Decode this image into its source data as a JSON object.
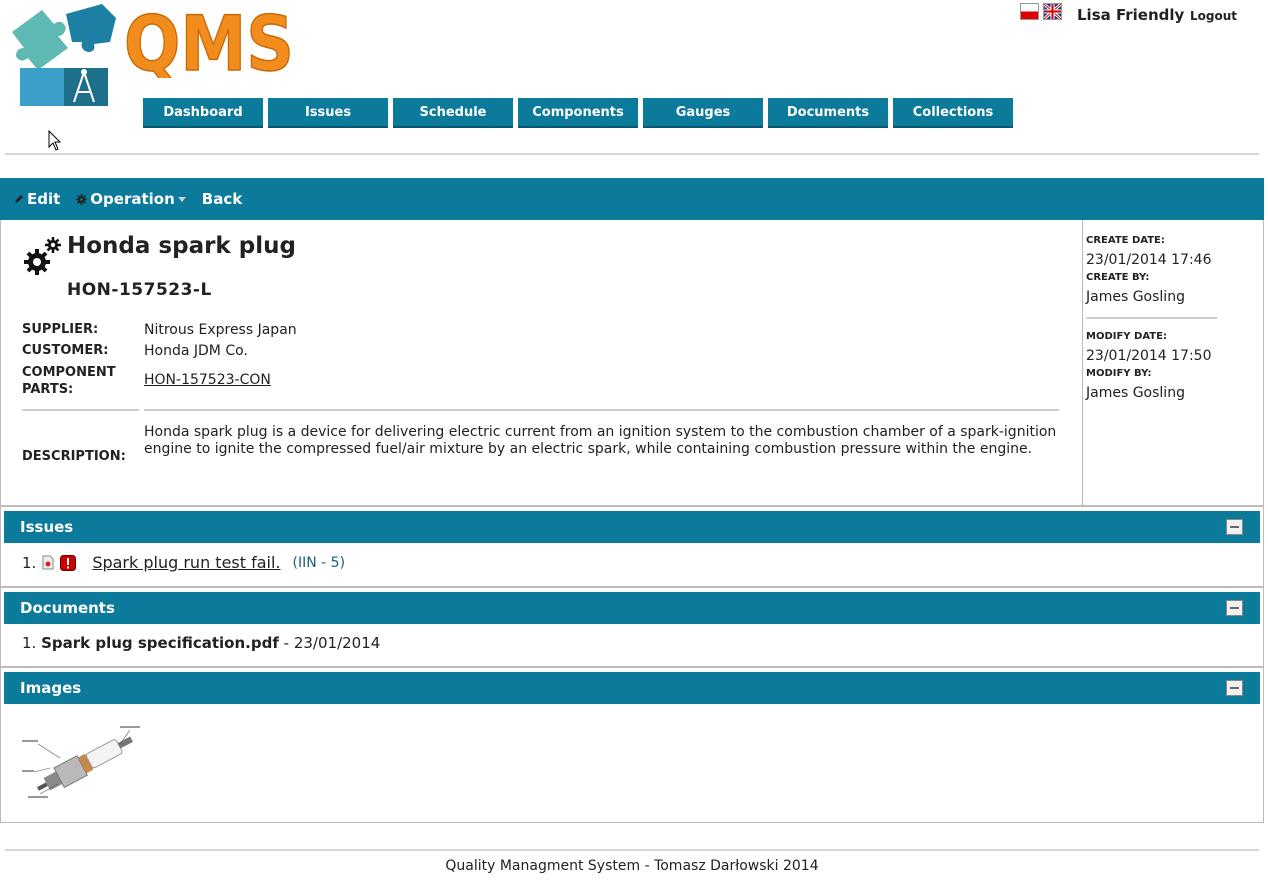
{
  "header": {
    "logo_text": "QMS",
    "user_name": "Lisa Friendly",
    "logout_label": "Logout",
    "languages": [
      "pl",
      "en"
    ]
  },
  "nav": {
    "items": [
      "Dashboard",
      "Issues",
      "Schedule",
      "Components",
      "Gauges",
      "Documents",
      "Collections"
    ]
  },
  "toolbar": {
    "edit_label": "Edit",
    "operation_label": "Operation",
    "back_label": "Back"
  },
  "component": {
    "name": "Honda spark plug",
    "code": "HON-157523-L",
    "supplier_label": "SUPPLIER:",
    "supplier": "Nitrous Express Japan",
    "customer_label": "CUSTOMER:",
    "customer": "Honda JDM Co.",
    "parts_label_1": "COMPONENT",
    "parts_label_2": "PARTS:",
    "parts": "HON-157523-CON",
    "description_label": "DESCRIPTION:",
    "description": "Honda spark plug is a device for delivering electric current from an ignition system to the combustion chamber of a spark-ignition engine to ignite the compressed fuel/air mixture by an electric spark, while containing combustion pressure within the engine."
  },
  "meta": {
    "create_date_label": "CREATE DATE:",
    "create_date": "23/01/2014 17:46",
    "create_by_label": "CREATE BY:",
    "create_by": "James Gosling",
    "modify_date_label": "MODIFY DATE:",
    "modify_date": "23/01/2014 17:50",
    "modify_by_label": "MODIFY BY:",
    "modify_by": "James Gosling"
  },
  "issues": {
    "title": "Issues",
    "items": [
      {
        "index": "1.",
        "title": "Spark plug run test fail.",
        "ref": "(IIN - 5)"
      }
    ]
  },
  "documents": {
    "title": "Documents",
    "items": [
      {
        "index": "1.",
        "name": "Spark plug specification.pdf",
        "date": "- 23/01/2014"
      }
    ]
  },
  "images": {
    "title": "Images"
  },
  "footer": {
    "text": "Quality Managment System - Tomasz Darłowski 2014"
  },
  "colors": {
    "accent": "#0b7a9b",
    "logo_orange": "#f28c1c"
  }
}
